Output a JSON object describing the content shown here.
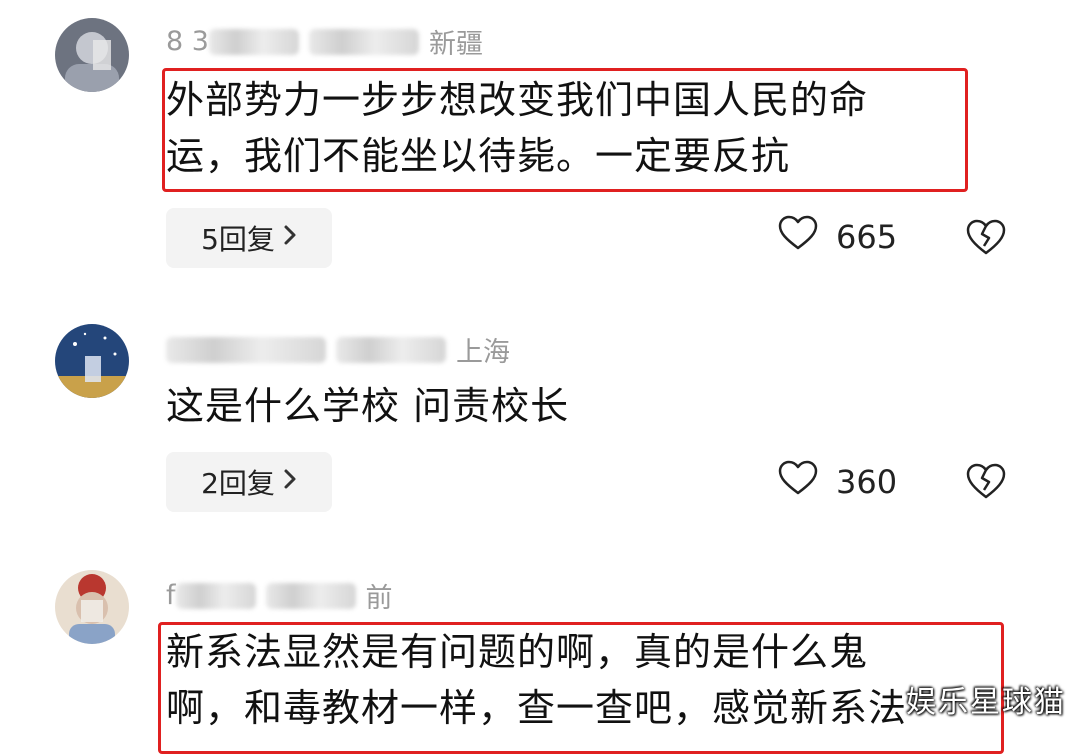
{
  "comments": [
    {
      "username": "8 3 ",
      "location": "新疆",
      "text_lines": [
        "外部势力一步步想改变我们中国人民的命",
        "运，我们不能坐以待毙。一定要反抗"
      ],
      "replies_label": "5回复",
      "likes": "665",
      "highlighted": true,
      "avatar_colors": [
        "#4a4f5a",
        "#7b8190"
      ],
      "avatar_icon": "user-avatar-icon"
    },
    {
      "username": "",
      "location": "上海",
      "text_lines": [
        "这是什么学校 问责校长"
      ],
      "replies_label": "2回复",
      "likes": "360",
      "highlighted": false,
      "avatar_colors": [
        "#2c4f86",
        "#c7a24a"
      ],
      "avatar_icon": "user-avatar-icon"
    },
    {
      "username": "f",
      "location": "前",
      "text_lines": [
        "新系法显然是有问题的啊，真的是什么鬼",
        "啊，和毒教材一样，查一查吧，感觉新系法"
      ],
      "highlighted": true,
      "avatar_colors": [
        "#e7d9c4",
        "#b9372f"
      ],
      "avatar_icon": "user-avatar-icon"
    }
  ],
  "icons": {
    "like": "heart-outline-icon",
    "dislike": "broken-heart-icon",
    "chevron": "chevron-right-icon"
  },
  "colors": {
    "highlight_border": "#e02020",
    "meta_text": "#9a9a9a",
    "reply_bg": "#f3f3f3"
  },
  "watermark": "娱乐星球猫"
}
